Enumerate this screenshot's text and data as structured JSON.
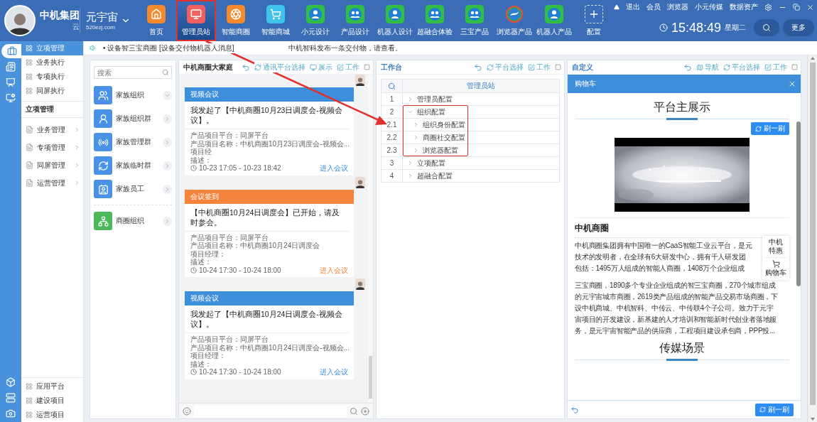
{
  "header": {
    "brand": {
      "name": "中机集团",
      "suffix": "云"
    },
    "site": {
      "name": "元宇宙",
      "domain": "520ezj.com"
    },
    "nav": [
      {
        "label": "首页",
        "kind": "home",
        "color": "#f5892c",
        "selected": false,
        "highlighted": false
      },
      {
        "label": "管理员站",
        "kind": "monitor",
        "color": "#f0605e",
        "selected": true,
        "highlighted": true
      },
      {
        "label": "智能商圈",
        "kind": "aperture",
        "color": "#f5892c",
        "selected": false,
        "highlighted": false
      },
      {
        "label": "智能商城",
        "kind": "cart",
        "color": "#3fc3ea",
        "selected": false,
        "highlighted": false
      },
      {
        "label": "小元设计",
        "kind": "robot",
        "color": "#2fbf45",
        "selected": false,
        "highlighted": false
      },
      {
        "label": "产品设计",
        "kind": "pair",
        "color": "#2fbf45",
        "selected": false,
        "highlighted": false
      },
      {
        "label": "机器人设计",
        "kind": "robot",
        "color": "#2fbf45",
        "selected": false,
        "highlighted": false
      },
      {
        "label": "超融合体验",
        "kind": "pair",
        "color": "#2fbf45",
        "selected": false,
        "highlighted": false
      },
      {
        "label": "三宝产品",
        "kind": "pair",
        "color": "#2fbf45",
        "selected": false,
        "highlighted": false
      },
      {
        "label": "浏览器产品",
        "kind": "swirl",
        "selected": false,
        "highlighted": false
      },
      {
        "label": "机器人产品",
        "kind": "robot",
        "color": "#2fbf45",
        "selected": false,
        "highlighted": false
      },
      {
        "label": "配置",
        "kind": "add",
        "selected": false,
        "highlighted": false
      }
    ],
    "links": [
      "退出",
      "会员",
      "浏览器",
      "小元传媒",
      "数据资产"
    ],
    "clock": {
      "time": "15:48:49",
      "weekday": "星期二"
    },
    "more_button": "更多"
  },
  "sidebar": {
    "rail_top": [
      {
        "kind": "briefcase",
        "selected": true
      },
      {
        "kind": "list",
        "selected": false
      },
      {
        "kind": "screen",
        "selected": false
      },
      {
        "kind": "screen-gear",
        "selected": false
      }
    ],
    "items": [
      {
        "label": "立项管理",
        "selected": true
      },
      {
        "label": "业务执行",
        "selected": false
      },
      {
        "label": "专项执行",
        "selected": false
      },
      {
        "label": "同屏执行",
        "selected": false
      }
    ],
    "section_title": "立项管理",
    "groups": [
      {
        "label": "业务管理"
      },
      {
        "label": "专项管理"
      },
      {
        "label": "同屏管理"
      },
      {
        "label": "运营管理"
      }
    ],
    "rail_bottom": [
      {
        "kind": "cube"
      },
      {
        "kind": "server"
      },
      {
        "kind": "gear-box"
      }
    ],
    "bottom_items": [
      {
        "label": "应用平台"
      },
      {
        "label": "建设项目"
      },
      {
        "label": "运营项目"
      }
    ]
  },
  "notice": {
    "prefix": "• 设备智三宝商圈 [设备交付物机器人消息]",
    "text": "中机智科发布一条交付物，请查看。"
  },
  "org": {
    "search_placeholder": "搜索",
    "groups": [
      {
        "label": "家族组织",
        "kind": "users",
        "divided": false,
        "color": "#4a92e6",
        "expanded": true
      },
      {
        "label": "家族组织群",
        "kind": "user",
        "divided": false,
        "color": "#4a92e6",
        "expanded": false
      },
      {
        "label": "家族管理群",
        "kind": "radio",
        "divided": false,
        "color": "#4a92e6",
        "expanded": false
      },
      {
        "label": "家族临时群",
        "kind": "cycle",
        "divided": false,
        "color": "#4a92e6",
        "expanded": false
      },
      {
        "label": "家族员工",
        "kind": "badge",
        "divided": false,
        "color": "#4a92e6",
        "expanded": false
      },
      {
        "label": "商圈组织",
        "kind": "network",
        "divided": true,
        "color": "#4cb85a",
        "expanded": false
      }
    ]
  },
  "chat": {
    "title": "中机商圈大家庭",
    "actions": [
      {
        "label": "通讯平台选择",
        "kind": "refresh"
      },
      {
        "label": "展示",
        "kind": "show"
      },
      {
        "label": "工作",
        "kind": "edit"
      }
    ],
    "messages": [
      {
        "kind": "video",
        "tag": "视频会议",
        "body": "我发起了【中机商圈10月23日调度会-视频会议】。",
        "fields": [
          "产品项目平台：同屏平台",
          "产品项目名称：中机商圈10月23日调度会-视频会...",
          "项目经",
          "描述："
        ],
        "time": "10-23 17:05 - 10-23 18:42",
        "link": "进入会议"
      },
      {
        "kind": "signin",
        "tag": "会议签到",
        "body": "【中机商圈10月24日调度会】已开始，请及时参会。",
        "fields": [
          "产品项目平台：同屏平台",
          "产品项目名称：中机商圈10月24日调度会",
          "项目经理：",
          "描述："
        ],
        "time": "10-24 17:30 - 10-24 18:00",
        "link": "进入会议"
      },
      {
        "kind": "video",
        "tag": "视频会议",
        "body": "我发起了【中机商圈10月24日调度会-视频会议】。",
        "fields": [
          "产品项目平台：同屏平台",
          "产品项目名称：中机商圈10月24日调度会-视频会...",
          "项目经理：",
          "描述："
        ],
        "time": "10-24 17:30 - 10-24 18:00",
        "link": "进入会议"
      }
    ]
  },
  "workspace": {
    "title": "工作台",
    "actions": [
      {
        "label": "平台选择",
        "kind": "refresh"
      },
      {
        "label": "工作",
        "kind": "edit"
      }
    ],
    "column": "管理员站",
    "rows": [
      {
        "number": "1",
        "label": "管理员配置",
        "expanded": false,
        "highlighted": false
      },
      {
        "number": "2",
        "label": "组织配置",
        "expanded": true,
        "highlighted": true,
        "children": [
          {
            "number": "2.1",
            "label": "组织身份配置",
            "expanded": false
          },
          {
            "number": "2.2",
            "label": "商圈社交配置",
            "expanded": false
          },
          {
            "number": "2.3",
            "label": "浏览器配置",
            "expanded": false
          }
        ]
      },
      {
        "number": "3",
        "label": "立项配置",
        "expanded": false,
        "highlighted": false
      },
      {
        "number": "4",
        "label": "超融合配置",
        "expanded": false,
        "highlighted": false
      }
    ]
  },
  "custom": {
    "title": "自定义",
    "actions": [
      {
        "label": "导航",
        "kind": "map"
      },
      {
        "label": "平台选择",
        "kind": "refresh"
      },
      {
        "label": "工作",
        "kind": "edit"
      }
    ],
    "drawer_title": "购物车",
    "showcase_title": "平台主展示",
    "refresh": "刷一刷",
    "article": {
      "title": "中机商圈",
      "lines": [
        "中机商圈集团拥有中国唯一的CaaS智能工业云平台，是元",
        "技术的发明者，在全球有6大研发中心，拥有千人研发团",
        "包括：1495万人组成的智能人商圈，1408万个企业组成",
        "三宝商圈，1890多个专业企业组成的智三宝商圈，270个城市组成",
        "的元宇宙城市商圈，2619类产品组成的智能产品交易市场商圈，下",
        "设中机商城、中机智科、中传云、中传联4个子公司。致力于元宇",
        "宙项目的开发建设，新基建的人才培训和智能新时代创业者落地服",
        "务，是元宇宙智能产品的供应商，工程项目建设承包商，PPP投..."
      ]
    },
    "float_menu": [
      {
        "label": "中机特惠",
        "kind": "text"
      },
      {
        "label": "购物车",
        "kind": "cart"
      }
    ],
    "next_title": "传媒场景",
    "bottom_refresh": "刷一刷"
  }
}
